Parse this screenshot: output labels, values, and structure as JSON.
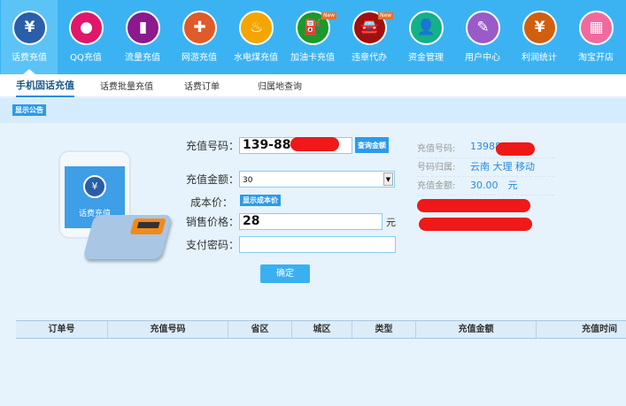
{
  "nav": [
    {
      "label": "话费充值",
      "icon": "mobile-yuan-icon",
      "glyph": "¥",
      "color": "#2a5ea8"
    },
    {
      "label": "QQ充值",
      "icon": "qq-penguin-icon",
      "glyph": "●",
      "color": "#e0176a"
    },
    {
      "label": "流量充值",
      "icon": "data-bars-icon",
      "glyph": "▮",
      "color": "#8b1a8f"
    },
    {
      "label": "网游充值",
      "icon": "gamepad-icon",
      "glyph": "✚",
      "color": "#e05a2a"
    },
    {
      "label": "水电煤充值",
      "icon": "utility-flame-icon",
      "glyph": "♨",
      "color": "#f5a500"
    },
    {
      "label": "加油卡充值",
      "icon": "fuel-pump-icon",
      "glyph": "⛽",
      "color": "#1a9a2a",
      "badge": "New"
    },
    {
      "label": "违章代办",
      "icon": "car-icon",
      "glyph": "🚘",
      "color": "#a01010",
      "badge": "New"
    },
    {
      "label": "资金管理",
      "icon": "user-icon",
      "glyph": "👤",
      "color": "#14b08a"
    },
    {
      "label": "用户中心",
      "icon": "user-edit-icon",
      "glyph": "✎",
      "color": "#9a5ac8"
    },
    {
      "label": "利润统计",
      "icon": "yuan-icon",
      "glyph": "¥",
      "color": "#d06010"
    },
    {
      "label": "淘宝开店",
      "icon": "grid-icon",
      "glyph": "▦",
      "color": "#f06aa0"
    }
  ],
  "tabs": [
    "手机固话充值",
    "话费批量充值",
    "话费订单",
    "归属地查询"
  ],
  "notice_btn": "显示公告",
  "illustration_label": "话费充值",
  "form": {
    "phone_label": "充值号码：",
    "phone_value": "139-8856",
    "query_btn": "查询金额",
    "amount_label": "充值金额：",
    "amount_value": "30",
    "cost_label": "成本价：",
    "cost_btn": "显示成本价",
    "price_label": "销售价格：",
    "price_value": "28",
    "price_unit": "元",
    "pwd_label": "支付密码：",
    "pwd_value": "",
    "submit": "确定"
  },
  "info": [
    {
      "label": "充值号码:",
      "value": "13988"
    },
    {
      "label": "号码归属:",
      "value": "云南 大理 移动"
    },
    {
      "label": "充值金额:",
      "value": "30.00　元"
    }
  ],
  "table_headers": [
    "订单号",
    "充值号码",
    "省区",
    "城区",
    "类型",
    "充值金额",
    "充值时间"
  ]
}
